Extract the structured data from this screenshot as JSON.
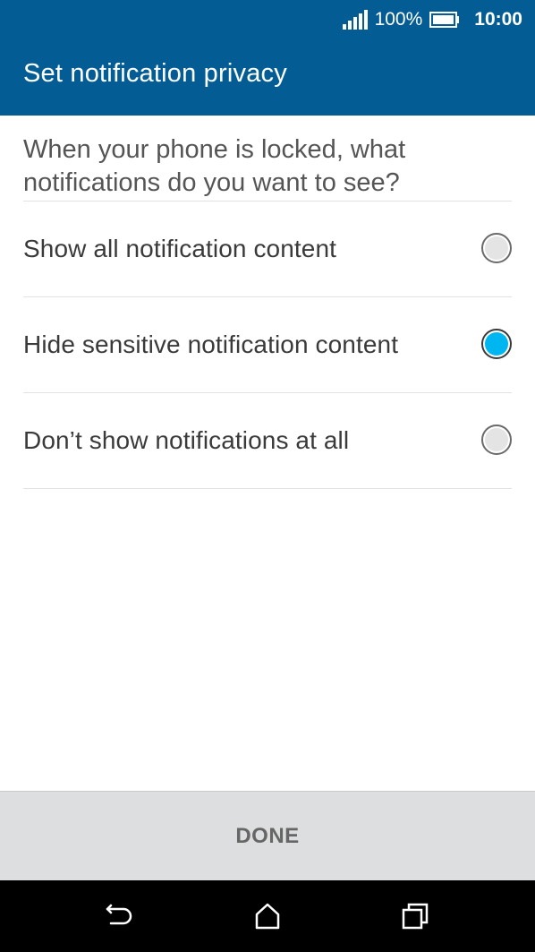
{
  "status_bar": {
    "battery_percent": "100%",
    "time": "10:00",
    "icons": [
      "signal-icon",
      "battery-icon"
    ]
  },
  "appbar": {
    "title": "Set notification privacy",
    "color": "#035d94"
  },
  "question": "When your phone is locked, what notifications do you want to see?",
  "options": [
    {
      "label": "Show all notification content",
      "selected": false
    },
    {
      "label": "Hide sensitive notification content",
      "selected": true
    },
    {
      "label": "Don’t show notifications at all",
      "selected": false
    }
  ],
  "accent_color": "#00b6f1",
  "done_label": "DONE",
  "nav_icons": [
    "back-icon",
    "home-icon",
    "recents-icon"
  ]
}
